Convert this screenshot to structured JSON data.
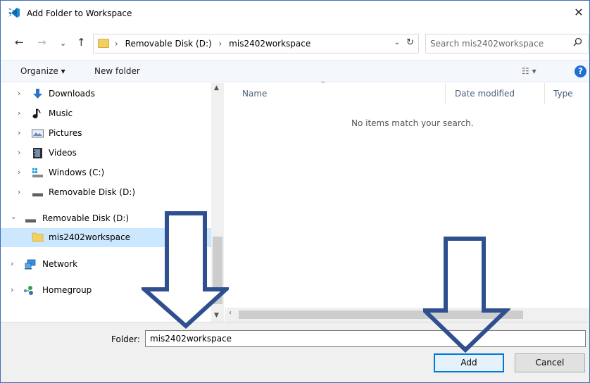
{
  "window": {
    "title": "Add Folder to Workspace",
    "close_glyph": "✕"
  },
  "nav_buttons": {
    "back": "←",
    "forward": "→",
    "recent": "⌄",
    "up": "↑"
  },
  "address": {
    "crumbs": [
      "Removable Disk (D:)",
      "mis2402workspace"
    ],
    "separator": "›",
    "dropdown_glyph": "⌄",
    "refresh_glyph": "↻"
  },
  "search": {
    "placeholder": "Search mis2402workspace",
    "icon": "search-icon"
  },
  "toolbar": {
    "organize_label": "Organize ▾",
    "new_folder_label": "New folder",
    "view_glyph": "☷ ▾",
    "help_glyph": "?"
  },
  "nav_tree": [
    {
      "label": "Downloads",
      "icon": "downloads-icon",
      "chevron": "›",
      "indent": 1
    },
    {
      "label": "Music",
      "icon": "music-icon",
      "chevron": "›",
      "indent": 1
    },
    {
      "label": "Pictures",
      "icon": "pictures-icon",
      "chevron": "›",
      "indent": 1
    },
    {
      "label": "Videos",
      "icon": "videos-icon",
      "chevron": "›",
      "indent": 1
    },
    {
      "label": "Windows (C:)",
      "icon": "drive-c-icon",
      "chevron": "›",
      "indent": 1
    },
    {
      "label": "Removable Disk (D:)",
      "icon": "removable-disk-icon",
      "chevron": "›",
      "indent": 1
    },
    {
      "label": "Removable Disk (D:)",
      "icon": "removable-disk-icon",
      "chevron": "⌄",
      "indent": 0
    },
    {
      "label": "mis2402workspace",
      "icon": "folder-icon",
      "chevron": "",
      "indent": 1,
      "selected": true
    },
    {
      "label": "Network",
      "icon": "network-icon",
      "chevron": "›",
      "indent": 0
    },
    {
      "label": "Homegroup",
      "icon": "homegroup-icon",
      "chevron": "›",
      "indent": 0
    }
  ],
  "file_list": {
    "columns": [
      "Name",
      "Date modified",
      "Type"
    ],
    "empty_message": "No items match your search."
  },
  "footer": {
    "folder_label": "Folder:",
    "folder_value": "mis2402workspace",
    "add_label": "Add",
    "cancel_label": "Cancel"
  },
  "colors": {
    "accent": "#0078d7",
    "selection": "#cce8ff",
    "annotation_arrow": "#2f4f8f"
  }
}
